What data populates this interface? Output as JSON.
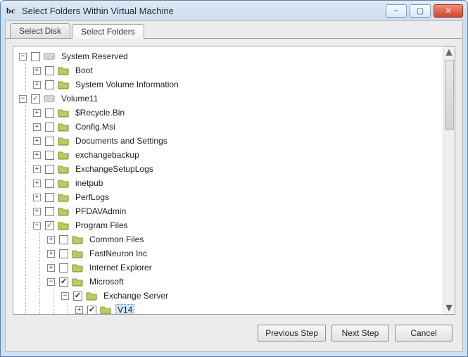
{
  "window": {
    "title": "Select Folders Within Virtual Machine",
    "app_icon": "bc"
  },
  "window_controls": {
    "minimize": "–",
    "maximize": "▢",
    "close": "✕"
  },
  "tabs": [
    {
      "id": "select-disk",
      "label": "Select Disk",
      "active": false
    },
    {
      "id": "select-folders",
      "label": "Select Folders",
      "active": true
    }
  ],
  "buttons": {
    "previous": "Previous Step",
    "next": "Next Step",
    "cancel": "Cancel"
  },
  "scrollbar": {
    "up": "▲",
    "down": "▼"
  },
  "tree": [
    {
      "depth": 0,
      "expander": "minus",
      "check": "none",
      "icon": "disk",
      "label": "System Reserved",
      "lastVert": false
    },
    {
      "depth": 1,
      "expander": "plus",
      "check": "none",
      "icon": "folder",
      "label": "Boot",
      "lastSibling": false
    },
    {
      "depth": 1,
      "expander": "plus",
      "check": "none",
      "icon": "folder",
      "label": "System Volume Information",
      "lastSibling": true
    },
    {
      "depth": 0,
      "expander": "minus",
      "check": "mixed",
      "icon": "disk",
      "label": "Volume11",
      "lastVert": true
    },
    {
      "depth": 1,
      "expander": "plus",
      "check": "none",
      "icon": "folder",
      "label": "$Recycle.Bin"
    },
    {
      "depth": 1,
      "expander": "plus",
      "check": "none",
      "icon": "folder",
      "label": "Config.Msi"
    },
    {
      "depth": 1,
      "expander": "plus",
      "check": "none",
      "icon": "folder",
      "label": "Documents and Settings"
    },
    {
      "depth": 1,
      "expander": "plus",
      "check": "none",
      "icon": "folder",
      "label": "exchangebackup"
    },
    {
      "depth": 1,
      "expander": "plus",
      "check": "none",
      "icon": "folder",
      "label": "ExchangeSetupLogs"
    },
    {
      "depth": 1,
      "expander": "plus",
      "check": "none",
      "icon": "folder",
      "label": "inetpub"
    },
    {
      "depth": 1,
      "expander": "plus",
      "check": "none",
      "icon": "folder",
      "label": "PerfLogs"
    },
    {
      "depth": 1,
      "expander": "plus",
      "check": "none",
      "icon": "folder",
      "label": "PFDAVAdmin"
    },
    {
      "depth": 1,
      "expander": "minus",
      "check": "mixed",
      "icon": "folder",
      "label": "Program Files"
    },
    {
      "depth": 2,
      "expander": "plus",
      "check": "none",
      "icon": "folder",
      "label": "Common Files"
    },
    {
      "depth": 2,
      "expander": "plus",
      "check": "none",
      "icon": "folder",
      "label": "FastNeuron Inc"
    },
    {
      "depth": 2,
      "expander": "plus",
      "check": "none",
      "icon": "folder",
      "label": "Internet Explorer"
    },
    {
      "depth": 2,
      "expander": "minus",
      "check": "checked",
      "icon": "folder",
      "label": "Microsoft"
    },
    {
      "depth": 3,
      "expander": "minus",
      "check": "checked",
      "icon": "folder",
      "label": "Exchange Server",
      "lastSibling": true
    },
    {
      "depth": 4,
      "expander": "plus",
      "check": "checked",
      "icon": "folder",
      "label": "V14",
      "selected": true,
      "lastSibling": true
    }
  ]
}
